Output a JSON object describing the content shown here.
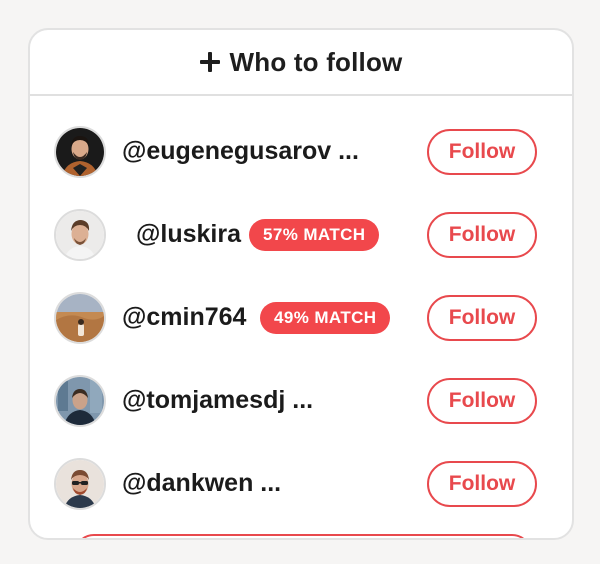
{
  "header": {
    "icon": "plus-icon",
    "title": "Who to follow"
  },
  "accent_color": "#e8494d",
  "badge_color": "#f2474b",
  "suggestions": [
    {
      "username": "@eugenegusarov ...",
      "match": null,
      "follow_label": "Follow",
      "avatar": "avatar-eugenegusarov"
    },
    {
      "username": "@luskira",
      "match": "57% MATCH",
      "follow_label": "Follow",
      "avatar": "avatar-luskira"
    },
    {
      "username": "@cmin764",
      "match": "49% MATCH",
      "follow_label": "Follow",
      "avatar": "avatar-cmin764"
    },
    {
      "username": "@tomjamesdj ...",
      "match": null,
      "follow_label": "Follow",
      "avatar": "avatar-tomjamesdj"
    },
    {
      "username": "@dankwen ...",
      "match": null,
      "follow_label": "Follow",
      "avatar": "avatar-dankwen"
    }
  ]
}
